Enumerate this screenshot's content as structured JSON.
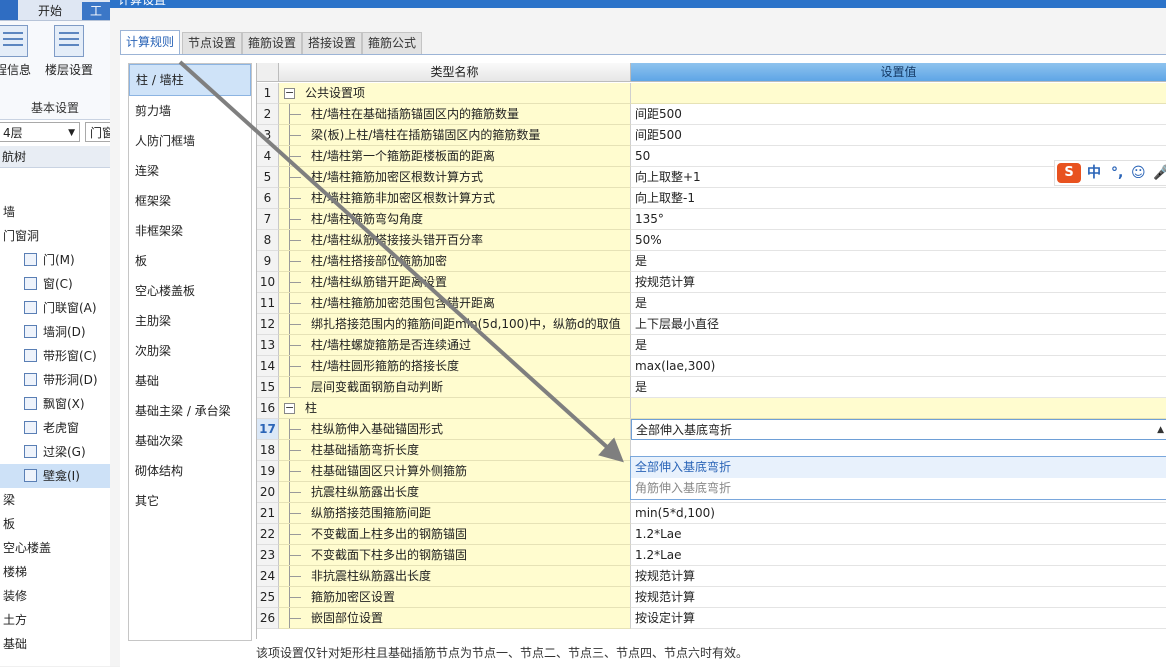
{
  "app": {
    "ribbon_tabs": [
      "开始",
      "工"
    ],
    "ribbon_buttons": {
      "project_info": "程信息",
      "floor_settings": "楼层设置"
    },
    "ribbon_group": "基本设置",
    "floor_select": "4层",
    "door_filter": "门窗",
    "nav_title": "航树",
    "nav_tree": [
      {
        "label": "墙",
        "level": 0,
        "icon": ""
      },
      {
        "label": "门窗洞",
        "level": 1,
        "icon": ""
      },
      {
        "label": "门(M)",
        "level": 2,
        "icon": "door-icon"
      },
      {
        "label": "窗(C)",
        "level": 2,
        "icon": "window-icon"
      },
      {
        "label": "门联窗(A)",
        "level": 2,
        "icon": "door-window-icon"
      },
      {
        "label": "墙洞(D)",
        "level": 2,
        "icon": "wall-hole-icon"
      },
      {
        "label": "带形窗(C)",
        "level": 2,
        "icon": "strip-window-icon"
      },
      {
        "label": "带形洞(D)",
        "level": 2,
        "icon": "strip-hole-icon"
      },
      {
        "label": "飘窗(X)",
        "level": 2,
        "icon": "bay-window-icon"
      },
      {
        "label": "老虎窗",
        "level": 2,
        "icon": "dormer-window-icon"
      },
      {
        "label": "过梁(G)",
        "level": 2,
        "icon": "lintel-icon"
      },
      {
        "label": "壁龛(I)",
        "level": 2,
        "icon": "niche-icon",
        "selected": true
      },
      {
        "label": "梁",
        "level": 0,
        "icon": ""
      },
      {
        "label": "板",
        "level": 0,
        "icon": ""
      },
      {
        "label": "空心楼盖",
        "level": 0,
        "icon": ""
      },
      {
        "label": "楼梯",
        "level": 0,
        "icon": ""
      },
      {
        "label": "装修",
        "level": 0,
        "icon": ""
      },
      {
        "label": "土方",
        "level": 0,
        "icon": ""
      },
      {
        "label": "基础",
        "level": 0,
        "icon": ""
      }
    ]
  },
  "dialog": {
    "title": "计算设置",
    "tabs": [
      "计算规则",
      "节点设置",
      "箍筋设置",
      "搭接设置",
      "箍筋公式"
    ],
    "active_tab": 0,
    "categories": [
      "柱 / 墙柱",
      "剪力墙",
      "人防门框墙",
      "连梁",
      "框架梁",
      "非框架梁",
      "板",
      "空心楼盖板",
      "主肋梁",
      "次肋梁",
      "基础",
      "基础主梁 / 承台梁",
      "基础次梁",
      "砌体结构",
      "其它"
    ],
    "selected_category": 0,
    "grid": {
      "col_name": "类型名称",
      "col_value": "设置值",
      "rows": [
        {
          "num": "1",
          "name": "公共设置项",
          "value": "",
          "group": true
        },
        {
          "num": "2",
          "name": "柱/墙柱在基础插筋锚固区内的箍筋数量",
          "value": "间距500"
        },
        {
          "num": "3",
          "name": "梁(板)上柱/墙柱在插筋锚固区内的箍筋数量",
          "value": "间距500"
        },
        {
          "num": "4",
          "name": "柱/墙柱第一个箍筋距楼板面的距离",
          "value": "50"
        },
        {
          "num": "5",
          "name": "柱/墙柱箍筋加密区根数计算方式",
          "value": "向上取整+1"
        },
        {
          "num": "6",
          "name": "柱/墙柱箍筋非加密区根数计算方式",
          "value": "向上取整-1"
        },
        {
          "num": "7",
          "name": "柱/墙柱箍筋弯勾角度",
          "value": "135°"
        },
        {
          "num": "8",
          "name": "柱/墙柱纵筋搭接接头错开百分率",
          "value": "50%"
        },
        {
          "num": "9",
          "name": "柱/墙柱搭接部位箍筋加密",
          "value": "是"
        },
        {
          "num": "10",
          "name": "柱/墙柱纵筋错开距离设置",
          "value": "按规范计算"
        },
        {
          "num": "11",
          "name": "柱/墙柱箍筋加密范围包含错开距离",
          "value": "是"
        },
        {
          "num": "12",
          "name": "绑扎搭接范围内的箍筋间距min(5d,100)中，纵筋d的取值",
          "value": "上下层最小直径"
        },
        {
          "num": "13",
          "name": "柱/墙柱螺旋箍筋是否连续通过",
          "value": "是"
        },
        {
          "num": "14",
          "name": "柱/墙柱圆形箍筋的搭接长度",
          "value": "max(lae,300)"
        },
        {
          "num": "15",
          "name": "层间变截面钢筋自动判断",
          "value": "是"
        },
        {
          "num": "16",
          "name": "柱",
          "value": "",
          "group": true
        },
        {
          "num": "17",
          "name": "柱纵筋伸入基础锚固形式",
          "value": "全部伸入基底弯折",
          "active": true
        },
        {
          "num": "18",
          "name": "柱基础插筋弯折长度",
          "value": ""
        },
        {
          "num": "19",
          "name": "柱基础锚固区只计算外侧箍筋",
          "value": ""
        },
        {
          "num": "20",
          "name": "抗震柱纵筋露出长度",
          "value": "按规范计算"
        },
        {
          "num": "21",
          "name": "纵筋搭接范围箍筋间距",
          "value": "min(5*d,100)"
        },
        {
          "num": "22",
          "name": "不变截面上柱多出的钢筋锚固",
          "value": "1.2*Lae"
        },
        {
          "num": "23",
          "name": "不变截面下柱多出的钢筋锚固",
          "value": "1.2*Lae"
        },
        {
          "num": "24",
          "name": "非抗震柱纵筋露出长度",
          "value": "按规范计算"
        },
        {
          "num": "25",
          "name": "箍筋加密区设置",
          "value": "按规范计算"
        },
        {
          "num": "26",
          "name": "嵌固部位设置",
          "value": "按设定计算"
        }
      ]
    },
    "dropdown_options": [
      "全部伸入基底弯折",
      "角筋伸入基底弯折"
    ],
    "footnote": "该项设置仅针对矩形柱且基础插筋节点为节点一、节点二、节点三、节点四、节点六时有效。"
  },
  "ime": {
    "logo": "S",
    "mode": "中",
    "punct": "°,",
    "emoji": "☺",
    "mic": "🎤"
  },
  "colors": {
    "accent": "#2b73c9",
    "header_blue": "#5ea5e6",
    "name_cell": "#fffccf",
    "arrow": "#7f7f7f"
  }
}
